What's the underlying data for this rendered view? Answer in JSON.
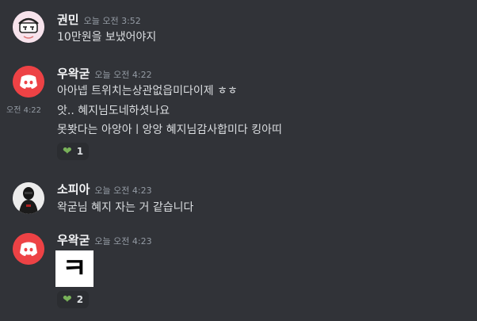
{
  "messages": [
    {
      "username": "권민",
      "timestamp": "오늘 오전 3:52",
      "lines": [
        "10만원을 보냈어야지"
      ]
    },
    {
      "username": "우왁굳",
      "timestamp": "오늘 오전 4:22",
      "lines": [
        "아아넵 트위치는상관없읍미다이제 ㅎㅎ"
      ],
      "followup": {
        "side_timestamp": "오전 4:22",
        "lines": [
          "앗.. 혜지님도네하셧나요",
          "못봣다는 아앙아ㅣ앙앙 혜지님감사합미다 킹아띠"
        ],
        "reaction": {
          "emoji": "heart-icon",
          "count": "1",
          "color": "#78b159"
        }
      }
    },
    {
      "username": "소피아",
      "timestamp": "오늘 오전 4:23",
      "lines": [
        "왁굳님 혜지 자는 거 같습니다"
      ]
    },
    {
      "username": "우왁굳",
      "timestamp": "오늘 오전 4:23",
      "attachment_text": "ㅋ",
      "reaction": {
        "emoji": "heart-icon",
        "count": "2",
        "color": "#78b159"
      }
    }
  ],
  "colors": {
    "background": "#313338",
    "discord_red": "#ed4245",
    "username": "#f2f3f5",
    "text": "#dbdee1",
    "muted": "#949ba4"
  }
}
